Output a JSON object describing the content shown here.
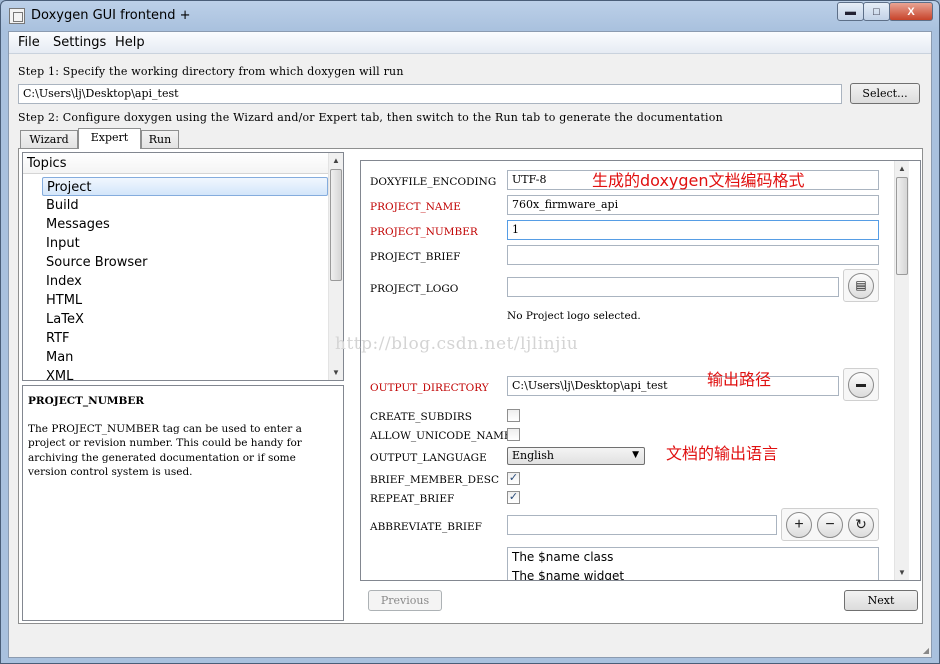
{
  "window": {
    "title": "Doxygen GUI frontend +",
    "controls": {
      "minimize": "▬",
      "maximize": "□",
      "close": "X"
    }
  },
  "menu": [
    "File",
    "Settings",
    "Help"
  ],
  "step1": {
    "label": "Step 1: Specify the working directory from which doxygen will run",
    "working_dir": "C:\\Users\\lj\\Desktop\\api_test",
    "select_button": "Select..."
  },
  "step2": {
    "label": "Step 2: Configure doxygen using the Wizard and/or Expert tab, then switch to the Run tab to generate the documentation"
  },
  "tabs": [
    {
      "label": "Wizard",
      "active": false
    },
    {
      "label": "Expert",
      "active": true
    },
    {
      "label": "Run",
      "active": false
    }
  ],
  "topics": {
    "header": "Topics",
    "items": [
      "Project",
      "Build",
      "Messages",
      "Input",
      "Source Browser",
      "Index",
      "HTML",
      "LaTeX",
      "RTF",
      "Man",
      "XML"
    ],
    "selected": "Project"
  },
  "help": {
    "title": "PROJECT_NUMBER",
    "text": "The PROJECT_NUMBER tag can be used to enter a project or revision number. This could be handy for archiving the generated documentation or if some version control system is used."
  },
  "options": {
    "doxyfile_encoding": {
      "label": "DOXYFILE_ENCODING",
      "value": "UTF-8"
    },
    "project_name": {
      "label": "PROJECT_NAME",
      "value": "760x_firmware_api"
    },
    "project_number": {
      "label": "PROJECT_NUMBER",
      "value": "1"
    },
    "project_brief": {
      "label": "PROJECT_BRIEF",
      "value": ""
    },
    "project_logo": {
      "label": "PROJECT_LOGO",
      "value": "",
      "note": "No Project logo selected."
    },
    "output_directory": {
      "label": "OUTPUT_DIRECTORY",
      "value": "C:\\Users\\lj\\Desktop\\api_test"
    },
    "create_subdirs": {
      "label": "CREATE_SUBDIRS",
      "checked": false
    },
    "allow_unicode_names": {
      "label": "ALLOW_UNICODE_NAMES",
      "checked": false
    },
    "output_language": {
      "label": "OUTPUT_LANGUAGE",
      "value": "English"
    },
    "brief_member_desc": {
      "label": "BRIEF_MEMBER_DESC",
      "checked": true
    },
    "repeat_brief": {
      "label": "REPEAT_BRIEF",
      "checked": true
    },
    "abbreviate_brief": {
      "label": "ABBREVIATE_BRIEF",
      "value": "",
      "list": [
        "The $name class",
        "The $name widget"
      ]
    }
  },
  "annotations": {
    "encoding": "生成的doxygen文档编码格式",
    "output_path": "输出路径",
    "language": "文档的输出语言"
  },
  "watermark": "http://blog.csdn.net/ljlinjiu",
  "nav": {
    "previous": "Previous",
    "next": "Next"
  },
  "glyphs": {
    "check": "✓",
    "plus": "+",
    "minus": "−",
    "reset": "↻",
    "file": "▤",
    "folder": "▬",
    "caret": "▼",
    "up": "▲",
    "down": "▼"
  }
}
